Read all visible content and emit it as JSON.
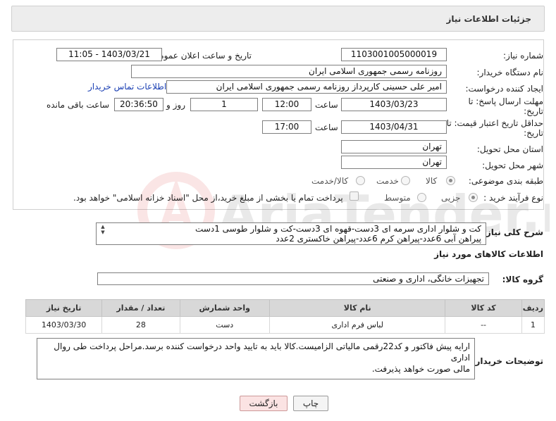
{
  "header": {
    "title": "جزئیات اطلاعات نیاز"
  },
  "form": {
    "need_number": {
      "label": "شماره نیاز:",
      "value": "1103001005000019"
    },
    "announce_datetime": {
      "label": "تاریخ و ساعت اعلان عمومی:",
      "value": "1403/03/21 - 11:05"
    },
    "buyer_org": {
      "label": "نام دستگاه خریدار:",
      "value": "روزنامه رسمی جمهوری اسلامی ایران"
    },
    "requester": {
      "label": "ایجاد کننده درخواست:",
      "value": "امیر علی حسینی کارپرداز روزنامه رسمی جمهوری اسلامی ایران"
    },
    "buyer_contact_link": "اطلاعات تماس خریدار",
    "deadline": {
      "label_line1": "مهلت ارسال پاسخ: تا",
      "label_line2": "تاریخ:",
      "date": "1403/03/23",
      "time_label": "ساعت",
      "time": "12:00",
      "days": "1",
      "days_label": "روز و",
      "remaining": "20:36:50",
      "remaining_label": "ساعت باقی مانده"
    },
    "price_validity": {
      "label_line1": "حداقل تاریخ اعتبار قیمت: تا",
      "label_line2": "تاریخ:",
      "date": "1403/04/31",
      "time_label": "ساعت",
      "time": "17:00"
    },
    "province": {
      "label": "استان محل تحویل:",
      "value": "تهران"
    },
    "city": {
      "label": "شهر محل تحویل:",
      "value": "تهران"
    },
    "category": {
      "label": "طبقه بندی موضوعی:",
      "options": [
        "کالا",
        "خدمت",
        "کالا/خدمت"
      ],
      "selected": "کالا"
    },
    "purchase_type": {
      "label": "نوع فرآیند خرید :",
      "options": [
        "جزیی",
        "متوسط"
      ],
      "selected": "جزیی",
      "treasury_note": "پرداخت تمام یا بخشی از مبلغ خرید،از محل \"اسناد خزانه اسلامی\" خواهد بود."
    }
  },
  "description": {
    "label": "شرح کلی نیاز:",
    "line1": "کت و شلوار اداری سرمه ای 3دست-قهوه ای 3دست-کت و شلوار طوسی 1دست",
    "line2": "پیراهن آبی 6عدد-پیراهن کرم 6عدد-پیراهن خاکستری 2عدد"
  },
  "goods": {
    "title": "اطلاعات کالاهای مورد نیاز",
    "group_label": "گروه کالا:",
    "group_value": "تجهیزات خانگی، اداری و صنعتی",
    "table": {
      "headers": [
        "ردیف",
        "کد کالا",
        "نام کالا",
        "واحد شمارش",
        "تعداد / مقدار",
        "تاریخ نیاز"
      ],
      "rows": [
        {
          "row": "1",
          "code": "--",
          "name": "لباس فرم اداری",
          "unit": "دست",
          "qty": "28",
          "date": "1403/03/30"
        }
      ]
    }
  },
  "buyer_notes": {
    "label": "توضیحات خریدار:",
    "line1": "ارایه پیش فاکتور و کد22رقمی مالیاتی الزامیست.کالا باید به تایید واحد درخواست کننده برسد.مراحل پرداخت طی روال اداری",
    "line2": "مالی صورت خواهد پذیرفت."
  },
  "buttons": {
    "print": "چاپ",
    "back": "بازگشت"
  },
  "watermark": {
    "text": "AriaTender.neT"
  }
}
